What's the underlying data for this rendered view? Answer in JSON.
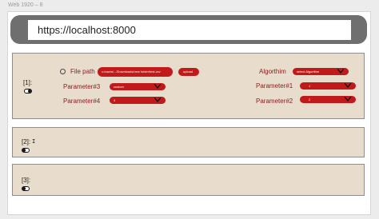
{
  "frame": {
    "label": "Web 1920 – 8"
  },
  "browser": {
    "url": "https://localhost:8000"
  },
  "panels": [
    {
      "index": "[1]:",
      "file_path": {
        "label": "File path",
        "value": "c:/users/.../Downloads/new folder/test.csv",
        "upload_label": "upload"
      },
      "algorithm": {
        "label": "Algorthim",
        "value": "select Algorithm"
      },
      "parameter3": {
        "label": "Parameter#3",
        "value": "custom"
      },
      "parameter4": {
        "label": "Parameter#4",
        "value": "4"
      },
      "parameter1": {
        "label": "Parameter#1",
        "value": "1"
      },
      "parameter2": {
        "label": "Parameter#2",
        "value": "2"
      }
    },
    {
      "index": "[2]:"
    },
    {
      "index": "[3]:"
    }
  ],
  "colors": {
    "accent": "#c11a1a",
    "label_text": "#8a1b1b",
    "panel_bg": "#e8dccd",
    "browser_bar": "#6f6f6f"
  },
  "icons": [
    "toggle-switch-icon",
    "radio-button-icon",
    "chevron-down-icon",
    "text-cursor-icon"
  ]
}
